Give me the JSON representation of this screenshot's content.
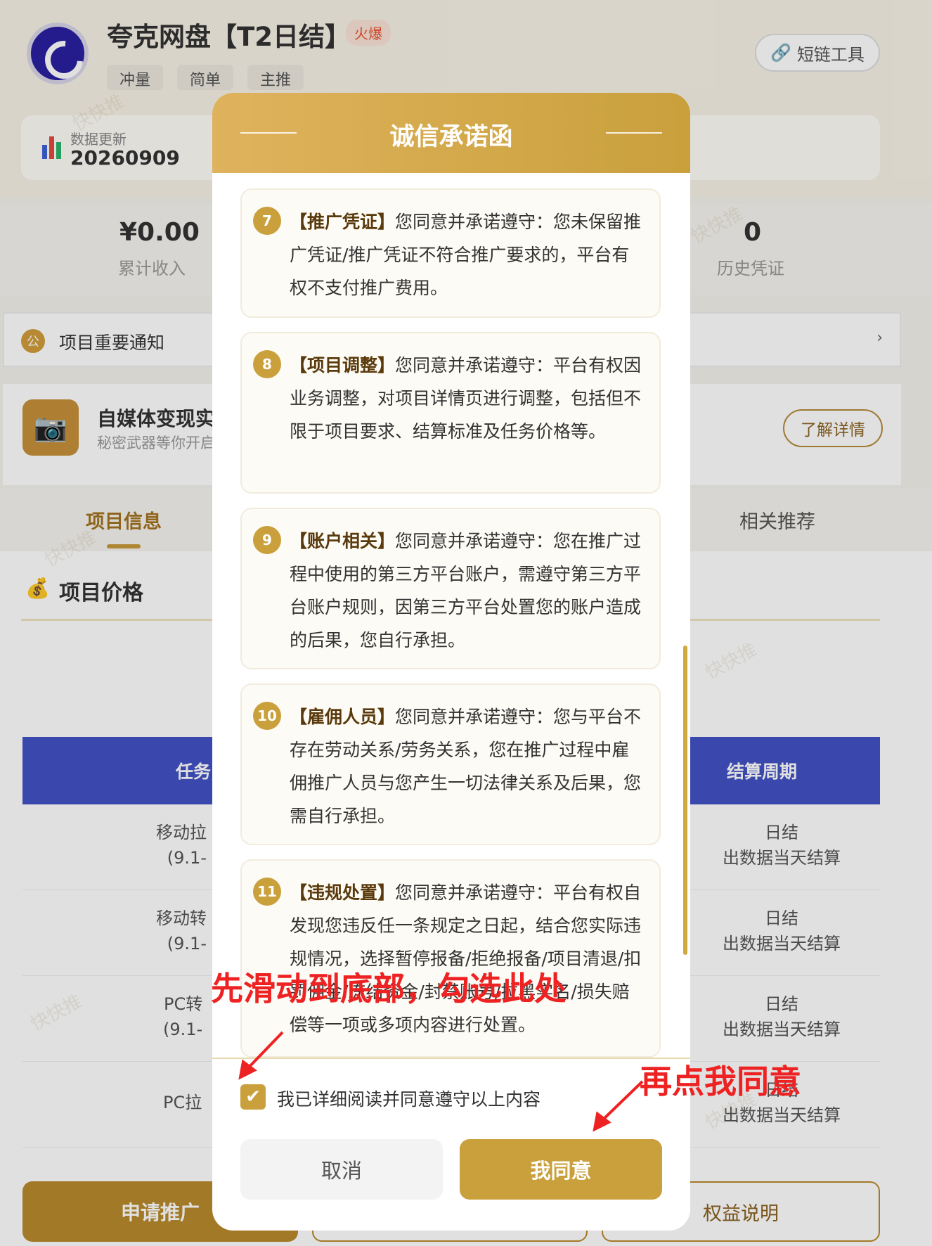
{
  "app": {
    "title": "夸克网盘【T2日结】",
    "hot_badge": "火爆",
    "tags": [
      "冲量",
      "简单",
      "主推"
    ],
    "shortlink_label": "短链工具"
  },
  "data_update": {
    "label": "数据更新",
    "value": "20260909"
  },
  "stats": [
    {
      "value": "¥0.00",
      "label": "累计收入"
    },
    {
      "value": "0",
      "label": "历史凭证"
    }
  ],
  "notice": {
    "label": "项目重要通知",
    "arrow": "›"
  },
  "promo": {
    "title": "自媒体变现实",
    "subtitle": "秘密武器等你开启",
    "button": "了解详情"
  },
  "tabs": [
    {
      "label": "项目信息",
      "active": true
    },
    {
      "label": "相关推荐",
      "active": false
    }
  ],
  "price": {
    "title": "项目价格",
    "table_headers": [
      "任务",
      "结算周期"
    ],
    "rows": [
      {
        "left1": "移动拉",
        "left2": "(9.1-",
        "right1": "日结",
        "right2": "出数据当天结算"
      },
      {
        "left1": "移动转",
        "left2": "(9.1-",
        "right1": "日结",
        "right2": "出数据当天结算"
      },
      {
        "left1": "PC转",
        "left2": "(9.1-",
        "right1": "日结",
        "right2": "出数据当天结算"
      },
      {
        "left1": "PC拉",
        "left2": "",
        "right1": "日结",
        "right2": "出数据当天结算"
      }
    ]
  },
  "bottom_bar": {
    "apply": "申请推广",
    "rights": "权益说明"
  },
  "modal": {
    "title": "诚信承诺函",
    "clauses": [
      {
        "num": "7",
        "head": "【推广凭证】",
        "body": "您同意并承诺遵守：您未保留推广凭证/推广凭证不符合推广要求的，平台有权不支付推广费用。"
      },
      {
        "num": "8",
        "head": "【项目调整】",
        "body": "您同意并承诺遵守：平台有权因业务调整，对项目详情页进行调整，包括但不限于项目要求、结算标准及任务价格等。"
      },
      {
        "num": "9",
        "head": "【账户相关】",
        "body": "您同意并承诺遵守：您在推广过程中使用的第三方平台账户，需遵守第三方平台账户规则，因第三方平台处置您的账户造成的后果，您自行承担。"
      },
      {
        "num": "10",
        "head": "【雇佣人员】",
        "body": "您同意并承诺遵守：您与平台不存在劳动关系/劳务关系，您在推广过程中雇佣推广人员与您产生一切法律关系及后果，您需自行承担。"
      },
      {
        "num": "11",
        "head": "【违规处置】",
        "body": "您同意并承诺遵守：平台有权自发现您违反任一条规定之日起，结合您实际违规情况，选择暂停报备/拒绝报备/项目清退/扣罚佣金/冻结资金/封禁账号/拉黑实名/损失赔偿等一项或多项内容进行处置。"
      }
    ],
    "agree_checkbox_label": "我已详细阅读并同意遵守以上内容",
    "checked": true,
    "cancel": "取消",
    "agree": "我同意"
  },
  "annotations": {
    "step1": "先滑动到底部，勾选此处",
    "step2": "再点我同意"
  },
  "watermark": "快快推",
  "colors": {
    "accent": "#c9a03c",
    "table_header": "#4252c7",
    "annotation": "#ee2222"
  }
}
